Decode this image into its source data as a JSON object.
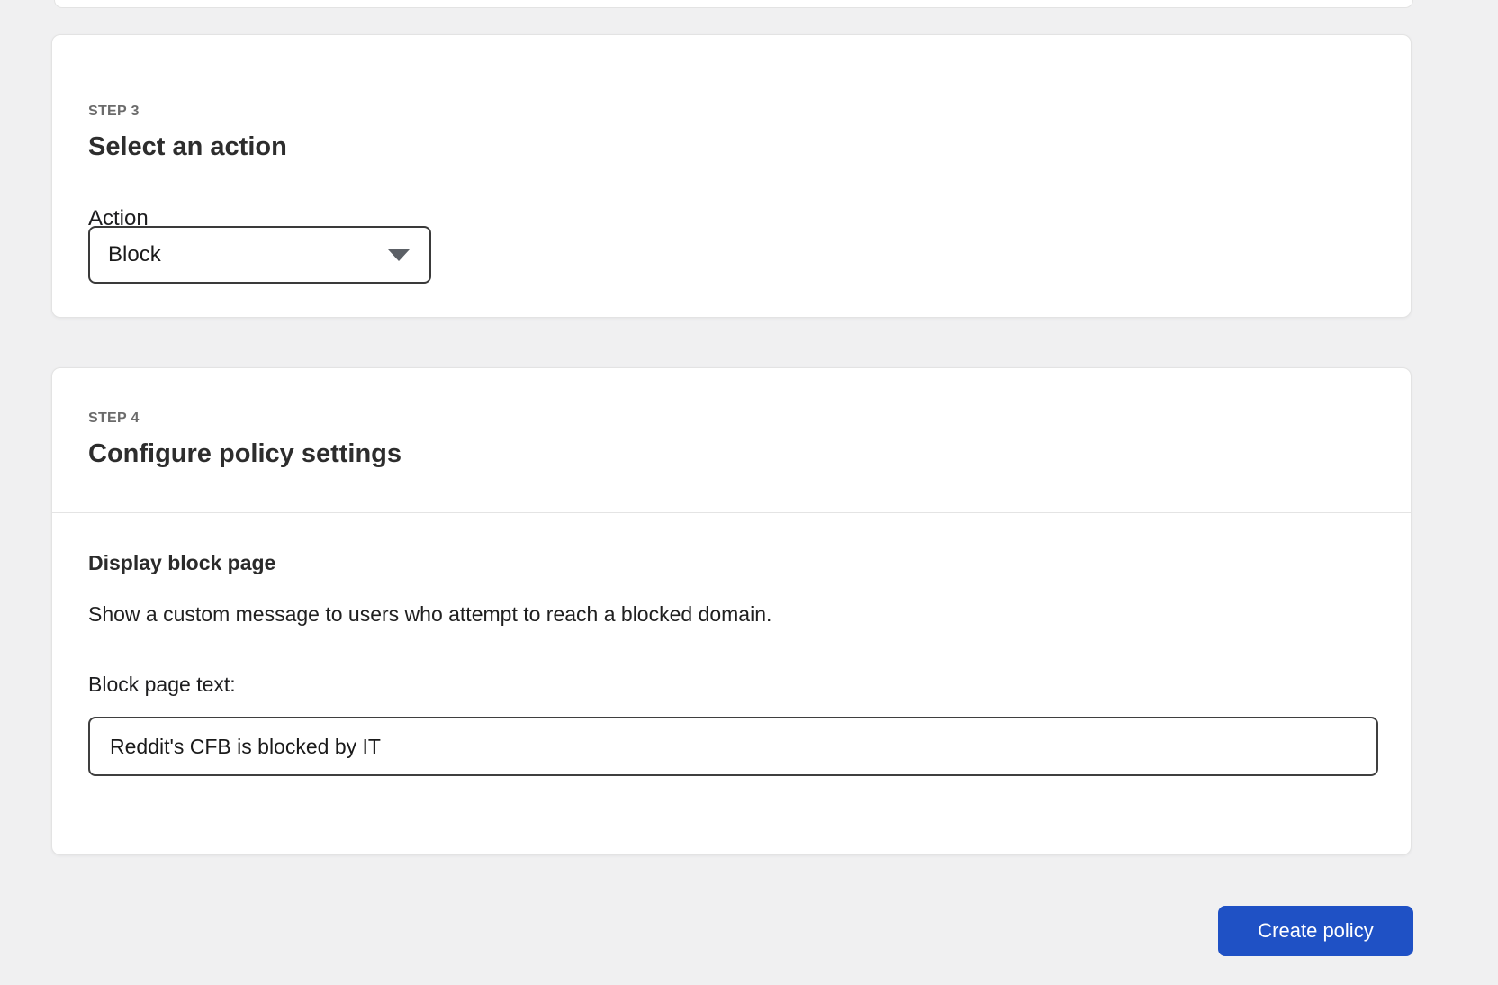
{
  "page": {
    "background_color": "#f0f0f1"
  },
  "step3_card": {
    "step_label": "STEP 3",
    "title": "Select an action",
    "action_field": {
      "label": "Action",
      "selected_value": "Block"
    }
  },
  "step4_card": {
    "step_label": "STEP 4",
    "title": "Configure policy settings",
    "display_block_page": {
      "heading": "Display block page",
      "description": "Show a custom message to users who attempt to reach a blocked domain.",
      "block_page_text_label": "Block page text:",
      "block_page_text_value": "Reddit's CFB is blocked by IT"
    }
  },
  "footer": {
    "create_policy_label": "Create policy"
  },
  "colors": {
    "primary_button": "#1f51c5",
    "card_background": "#ffffff",
    "input_border": "#3f3f3f",
    "step_label_text": "#6b6b6b",
    "heading_text": "#2d2d2d",
    "divider": "#e4e4e4"
  },
  "icons": {
    "chevron_down": "caret pointing down in action select"
  }
}
